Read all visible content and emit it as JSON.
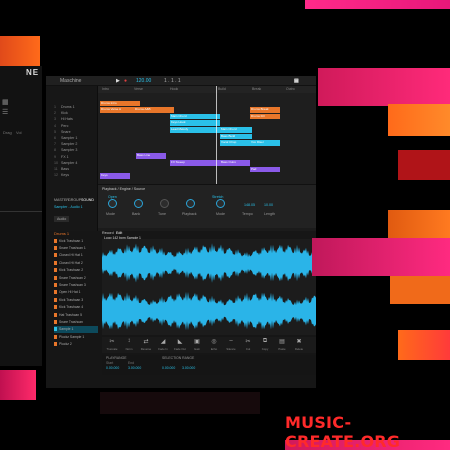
{
  "left_panel": {
    "logo": "NE",
    "labels": [
      "Drag",
      "Vol"
    ]
  },
  "topbar": {
    "title": "Maschine",
    "play_icon": "play-icon",
    "record_icon": "record-icon",
    "bpm": "120.00",
    "position": "1 . 1 . 1"
  },
  "tracks": [
    {
      "num": "1",
      "name": "Drums 1"
    },
    {
      "num": "2",
      "name": "Kick"
    },
    {
      "num": "3",
      "name": "Hi Hats"
    },
    {
      "num": "4",
      "name": "Perc"
    },
    {
      "num": "5",
      "name": "Snare"
    },
    {
      "num": "6",
      "name": "Sampler 1"
    },
    {
      "num": "7",
      "name": "Sampler 2"
    },
    {
      "num": "8",
      "name": "Sampler 3"
    },
    {
      "num": "9",
      "name": "FX 1"
    },
    {
      "num": "10",
      "name": "Sampler 4"
    },
    {
      "num": "11",
      "name": "Bass"
    },
    {
      "num": "12",
      "name": "Keys"
    }
  ],
  "scenes": [
    "Intro",
    "Verse",
    "Hook",
    "Build",
    "Break",
    "Outro"
  ],
  "clips": [
    {
      "label": "Drums Intro",
      "color": "#e8762a"
    },
    {
      "label": "Drums Verse A",
      "color": "#e8762a"
    },
    {
      "label": "Drums A&B",
      "color": "#e8762a"
    },
    {
      "label": "Drums Break",
      "color": "#e8762a"
    },
    {
      "label": "Drums Fill",
      "color": "#e8762a"
    },
    {
      "label": "Main Chord",
      "color": "#2ac0e8"
    },
    {
      "label": "Keys Hook",
      "color": "#2ac0e8"
    },
    {
      "label": "Lead Melody",
      "color": "#2ac0e8"
    },
    {
      "label": "Main Chord",
      "color": "#2ac0e8"
    },
    {
      "label": "Bass Build",
      "color": "#2ac0e8"
    },
    {
      "label": "Vocal Chop",
      "color": "#2ac0e8"
    },
    {
      "label": "Vox Riser",
      "color": "#2ac0e8"
    },
    {
      "label": "Bass Line",
      "color": "#8a5ae8"
    },
    {
      "label": "FX Sweep",
      "color": "#8a5ae8"
    },
    {
      "label": "Bass Outro",
      "color": "#8a5ae8"
    },
    {
      "label": "Pad",
      "color": "#8a5ae8"
    },
    {
      "label": "Keys",
      "color": "#8a5ae8"
    }
  ],
  "mid_tabs": [
    "MASTER",
    "GROUP",
    "SOUND"
  ],
  "props": {
    "header": "Playback / Engine / Source",
    "params": [
      "Mode",
      "Bank",
      "Tune",
      "Playback",
      "Mode",
      "Tempo",
      "Length"
    ],
    "values": [
      "Open",
      "Stretch",
      "148.05",
      "10.00"
    ],
    "preset": "Sampler - Audio 1",
    "audio_label": "Audio"
  },
  "sampler": {
    "group": "Drums 1",
    "tabs": [
      "Record",
      "Edit"
    ],
    "sample_name": "Loop 142 bpm Sample 1",
    "slots": [
      {
        "name": "Kick Trashcan 1",
        "color": "#e8762a"
      },
      {
        "name": "Snare Trashcan 1",
        "color": "#e8762a"
      },
      {
        "name": "Closed Hi Hat 1",
        "color": "#e8762a"
      },
      {
        "name": "Closed Hi Hat 2",
        "color": "#e8762a"
      },
      {
        "name": "Kick Trashcan 2",
        "color": "#e8762a"
      },
      {
        "name": "Snare Trashcan 2",
        "color": "#e8762a"
      },
      {
        "name": "Snare Trashcan 3",
        "color": "#e8762a"
      },
      {
        "name": "Open Hi Hat 1",
        "color": "#e8762a"
      },
      {
        "name": "Kick Trashcan 3",
        "color": "#e8762a"
      },
      {
        "name": "Kick Trashcan 4",
        "color": "#e8762a"
      },
      {
        "name": "Hat Trashcan 5",
        "color": "#e8762a"
      },
      {
        "name": "Snare Trashcan",
        "color": "#e8762a"
      },
      {
        "name": "Sample 1",
        "color": "#2ac0e8"
      },
      {
        "name": "Pluckz Sample 1",
        "color": "#e8762a"
      },
      {
        "name": "Pluckz 2",
        "color": "#e8762a"
      }
    ],
    "tools": [
      "Truncate",
      "Norm",
      "Reverse",
      "Fade In",
      "Fade Out",
      "Gain",
      "Echo",
      "Silence",
      "Cut",
      "Copy",
      "Paste",
      "Delete"
    ],
    "playrange_label": "PLAYRANGE",
    "selection_label": "SELECTION RANGE",
    "start_label": "Start",
    "end_label": "End",
    "start_value": "0.00.000",
    "end_value": "3.00.000",
    "sel_start_value": "0.00.000",
    "sel_end_value": "3.00.000"
  },
  "watermark": "MUSIC-CREATE.ORG"
}
